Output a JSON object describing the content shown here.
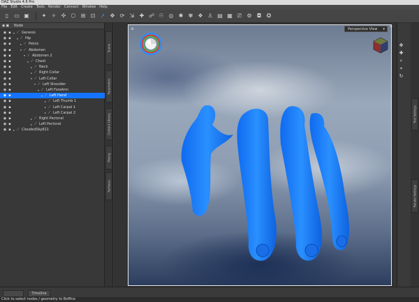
{
  "app": {
    "title": "DAZ Studio 4.6 Pro"
  },
  "menu": [
    "File",
    "Edit",
    "Create",
    "Tools",
    "Render",
    "Connect",
    "Window",
    "Help"
  ],
  "scene": {
    "header": "Node",
    "nodes": [
      {
        "label": "Genesis",
        "depth": 0,
        "expanded": true,
        "selected": false
      },
      {
        "label": "Hip",
        "depth": 1,
        "expanded": true,
        "selected": false
      },
      {
        "label": "Pelvis",
        "depth": 2,
        "expanded": false,
        "selected": false
      },
      {
        "label": "Abdomen",
        "depth": 2,
        "expanded": true,
        "selected": false
      },
      {
        "label": "Abdomen 2",
        "depth": 3,
        "expanded": true,
        "selected": false
      },
      {
        "label": "Chest",
        "depth": 4,
        "expanded": true,
        "selected": false
      },
      {
        "label": "Neck",
        "depth": 5,
        "expanded": false,
        "selected": false
      },
      {
        "label": "Right Collar",
        "depth": 5,
        "expanded": false,
        "selected": false
      },
      {
        "label": "Left Collar",
        "depth": 5,
        "expanded": true,
        "selected": false
      },
      {
        "label": "Left Shoulder",
        "depth": 6,
        "expanded": true,
        "selected": false
      },
      {
        "label": "Left ForeArm",
        "depth": 7,
        "expanded": true,
        "selected": false
      },
      {
        "label": "Left Hand",
        "depth": 8,
        "expanded": true,
        "selected": true
      },
      {
        "label": "Left Thumb 1",
        "depth": 9,
        "expanded": false,
        "selected": false
      },
      {
        "label": "Left Carpal 1",
        "depth": 9,
        "expanded": false,
        "selected": false
      },
      {
        "label": "Left Carpal 2",
        "depth": 9,
        "expanded": false,
        "selected": false
      },
      {
        "label": "Right Pectoral",
        "depth": 5,
        "expanded": false,
        "selected": false
      },
      {
        "label": "Left Pectoral",
        "depth": 5,
        "expanded": false,
        "selected": false
      },
      {
        "label": "CloudedSky821",
        "depth": 0,
        "expanded": false,
        "selected": false
      }
    ]
  },
  "left_tabs": [
    "Scene",
    "Parameters",
    "Content Library",
    "Posing",
    "Surfaces"
  ],
  "viewport": {
    "camera": "Perspective View"
  },
  "right_tabs": [
    "Tool Settings",
    "Render Settings"
  ],
  "bottom_tabs": [
    "",
    "Timeline"
  ],
  "status": "Click to select nodes / geometry to Boffice",
  "colors": {
    "selection": "#1574ff",
    "hand": "#1a7dff"
  }
}
